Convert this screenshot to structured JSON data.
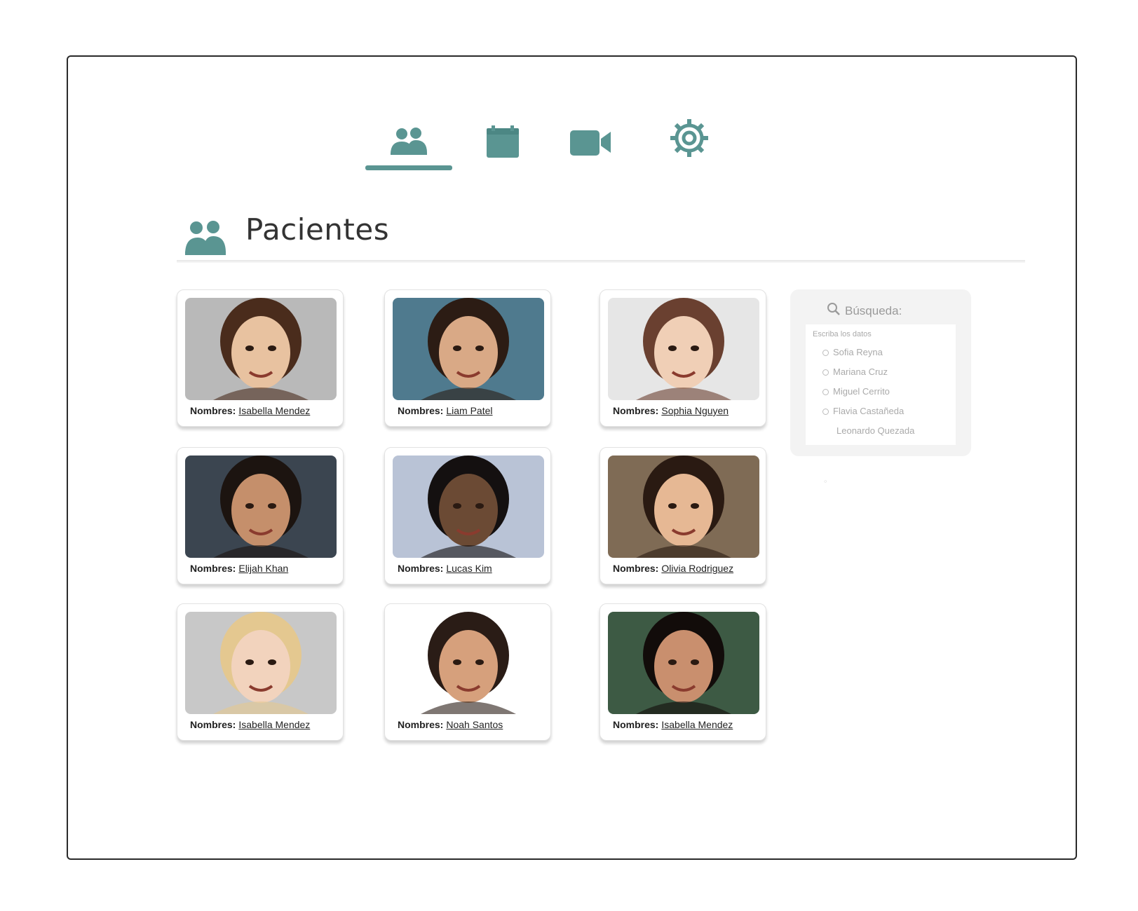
{
  "nav": {
    "items": [
      {
        "name": "pacientes",
        "icon": "users-icon",
        "active": true
      },
      {
        "name": "calendario",
        "icon": "calendar-icon",
        "active": false
      },
      {
        "name": "videollamada",
        "icon": "video-camera-icon",
        "active": false
      },
      {
        "name": "configuracion",
        "icon": "gear-icon",
        "active": false
      }
    ]
  },
  "page": {
    "title": "Pacientes",
    "title_icon": "users-icon"
  },
  "cards": [
    {
      "label": "Nombres:",
      "name": "Isabella Mendez",
      "photo": "woman-glasses-avatar"
    },
    {
      "label": "Nombres:",
      "name": "Liam Patel",
      "photo": "man-smiling-avatar"
    },
    {
      "label": "Nombres:",
      "name": "Sophia Nguyen",
      "photo": "woman-short-hair-avatar"
    },
    {
      "label": "Nombres:",
      "name": "Elijah Khan",
      "photo": "man-beard-avatar"
    },
    {
      "label": "Nombres:",
      "name": "Lucas Kim",
      "photo": "young-man-avatar"
    },
    {
      "label": "Nombres:",
      "name": "Olivia Rodriguez",
      "photo": "woman-smiling-avatar"
    },
    {
      "label": "Nombres:",
      "name": "Isabella Mendez",
      "photo": "blonde-woman-avatar"
    },
    {
      "label": "Nombres:",
      "name": "Noah Santos",
      "photo": "man-white-shirt-avatar"
    },
    {
      "label": "Nombres:",
      "name": "Isabella Mendez",
      "photo": "woman-dark-hair-avatar"
    }
  ],
  "search": {
    "title": "Búsqueda:",
    "subtitle": "Escriba los datos",
    "results": [
      {
        "name": "Sofia Reyna",
        "dot": true
      },
      {
        "name": "Mariana Cruz",
        "dot": true
      },
      {
        "name": "Miguel Cerrito",
        "dot": true
      },
      {
        "name": "Flavia Castañeda",
        "dot": true
      },
      {
        "name": "Leonardo Quezada",
        "dot": false
      }
    ]
  },
  "colors": {
    "accent": "#5a9592",
    "frame": "#2a2a2a",
    "panel": "#f3f3f3"
  }
}
